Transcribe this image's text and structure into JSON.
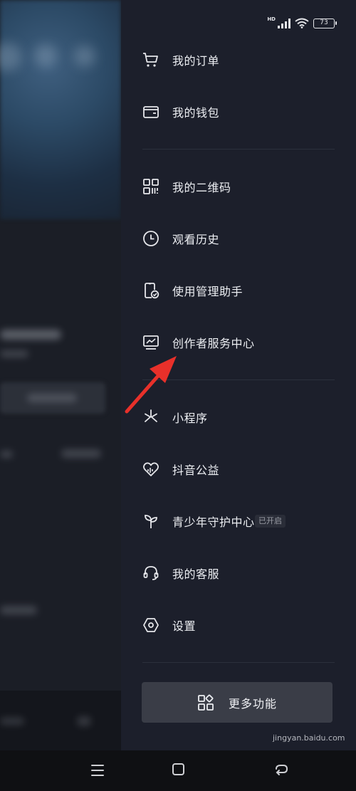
{
  "status_bar": {
    "network": "HD",
    "battery": "73"
  },
  "drawer": {
    "group1": [
      {
        "label": "我的订单",
        "icon": "cart-icon"
      },
      {
        "label": "我的钱包",
        "icon": "wallet-icon"
      }
    ],
    "group2": [
      {
        "label": "我的二维码",
        "icon": "qr-code-icon"
      },
      {
        "label": "观看历史",
        "icon": "clock-icon"
      },
      {
        "label": "使用管理助手",
        "icon": "phone-check-icon"
      },
      {
        "label": "创作者服务中心",
        "icon": "monitor-chart-icon"
      }
    ],
    "group3": [
      {
        "label": "小程序",
        "icon": "mini-program-icon"
      },
      {
        "label": "抖音公益",
        "icon": "heart-chart-icon"
      },
      {
        "label": "青少年守护中心",
        "icon": "sprout-icon",
        "badge": "已开启"
      },
      {
        "label": "我的客服",
        "icon": "headset-icon"
      },
      {
        "label": "设置",
        "icon": "hexagon-settings-icon"
      }
    ],
    "more_button": {
      "label": "更多功能",
      "icon": "grid-shapes-icon"
    }
  },
  "watermark": "jingyan.baidu.com",
  "colors": {
    "drawer_bg": "#1c1f2b",
    "arrow": "#e8302a",
    "button_bg": "#3a3d47"
  }
}
